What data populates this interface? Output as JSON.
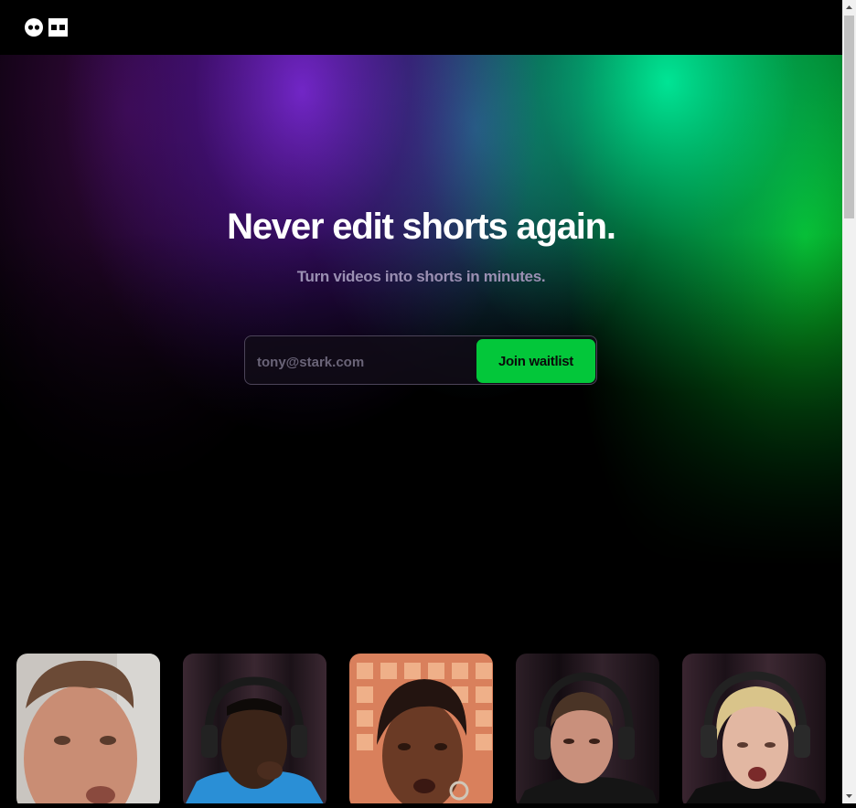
{
  "hero": {
    "title": "Never edit shorts again.",
    "subtitle": "Turn videos into shorts in minutes."
  },
  "waitlist": {
    "placeholder": "tony@stark.com",
    "button_label": "Join waitlist"
  },
  "icons": {
    "logo": "logo-icon",
    "scroll_up": "scroll-up-arrow-icon",
    "scroll_down": "scroll-down-arrow-icon"
  },
  "colors": {
    "background": "#000000",
    "accent_green": "#03c73a",
    "gradient_purple": "#7828d2",
    "gradient_teal": "#00e696",
    "subtitle_text": "#9a8fb2"
  },
  "gallery": [
    {
      "id": "thumb-1",
      "description": "man with short brown hair"
    },
    {
      "id": "thumb-2",
      "description": "man with headphones in blue hoodie"
    },
    {
      "id": "thumb-3",
      "description": "woman with braided hair"
    },
    {
      "id": "thumb-4",
      "description": "man with headphones"
    },
    {
      "id": "thumb-5",
      "description": "woman with blonde hair and headphones"
    }
  ]
}
